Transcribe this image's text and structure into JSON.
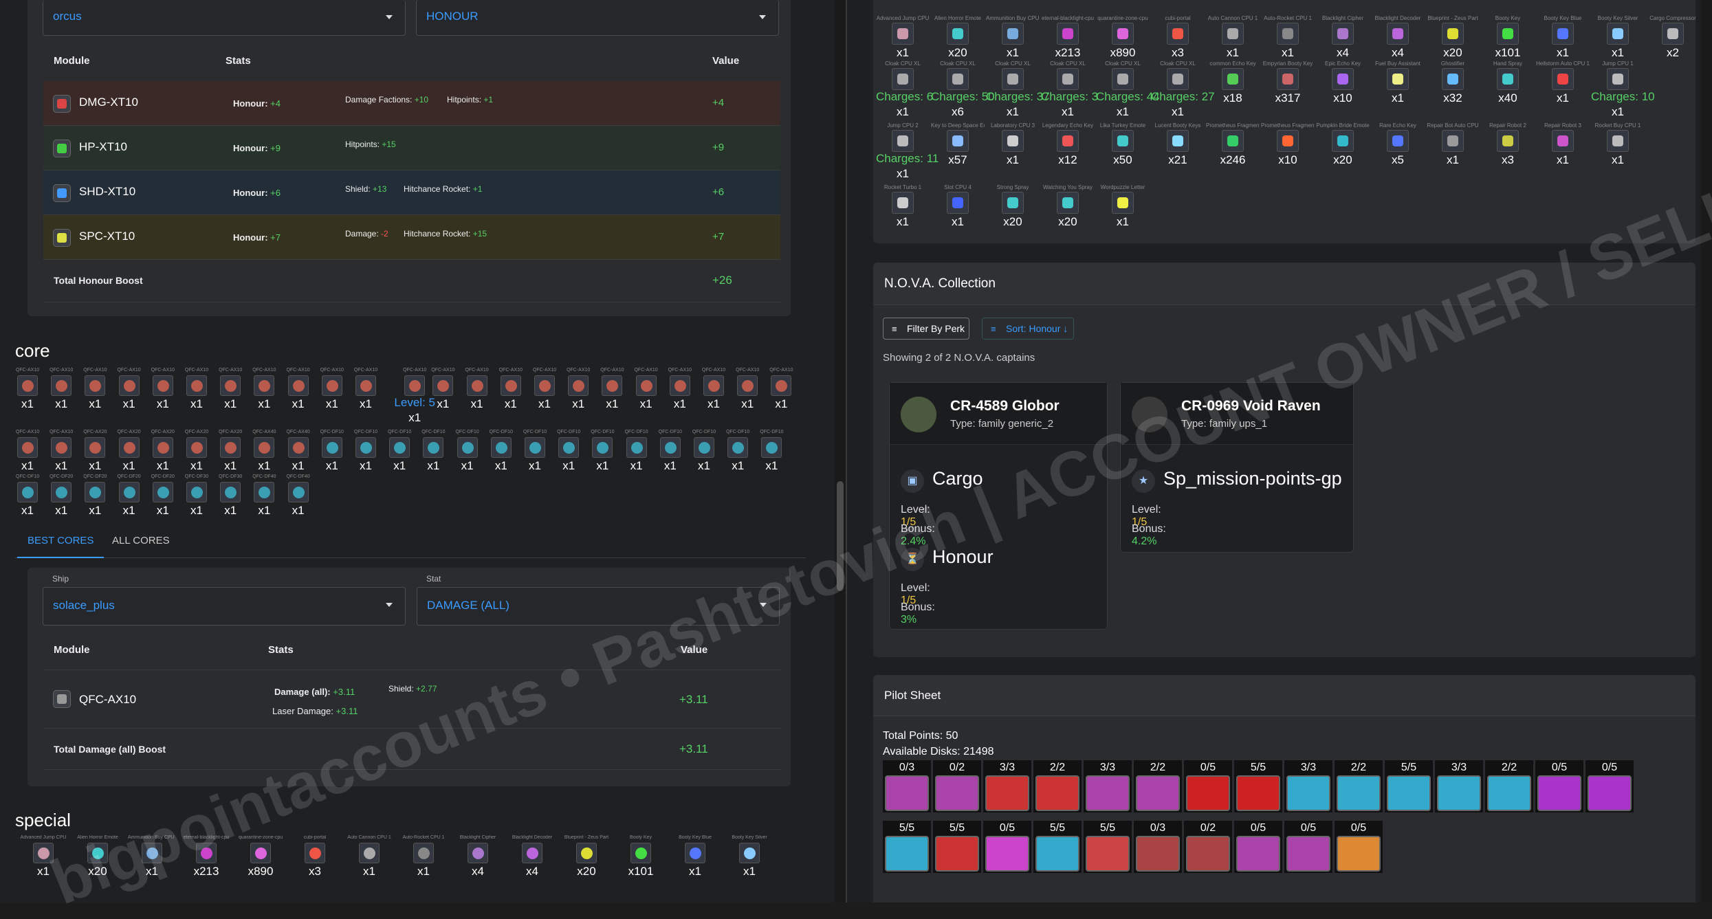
{
  "left": {
    "top_selects": {
      "ship": "orcus",
      "stat": "HONOUR"
    },
    "honour_table": {
      "headers": [
        "Module",
        "Stats",
        "Value"
      ],
      "rows": [
        {
          "module": "DMG-XT10",
          "honour_label": "Honour:",
          "honour_val": "+4",
          "s1_label": "Damage Factions:",
          "s1_val": "+10",
          "s2_label": "Hitpoints:",
          "s2_val": "+1",
          "value": "+4",
          "bg": "#3a2926",
          "icon": "#d44"
        },
        {
          "module": "HP-XT10",
          "honour_label": "Honour:",
          "honour_val": "+9",
          "s1_label": "Hitpoints:",
          "s1_val": "+15",
          "s2_label": "",
          "s2_val": "",
          "value": "+9",
          "bg": "#27332a",
          "icon": "#4c4"
        },
        {
          "module": "SHD-XT10",
          "honour_label": "Honour:",
          "honour_val": "+6",
          "s1_label": "Shield:",
          "s1_val": "+13",
          "s2_label": "Hitchance Rocket:",
          "s2_val": "+1",
          "value": "+6",
          "bg": "#232d38",
          "icon": "#49f"
        },
        {
          "module": "SPC-XT10",
          "honour_label": "Honour:",
          "honour_val": "+7",
          "s1_label": "Damage:",
          "s1_val": "-2",
          "s2_label": "Hitchance Rocket:",
          "s2_val": "+15",
          "value": "+7",
          "bg": "#35331f",
          "icon": "#dd4"
        }
      ],
      "total_label": "Total Honour Boost",
      "total_value": "+26"
    },
    "core_title": "core",
    "core_level_text": "Level: 5",
    "tabs": [
      "BEST CORES",
      "ALL CORES"
    ],
    "core_selects": {
      "ship_label": "Ship",
      "ship": "solace_plus",
      "stat_label": "Stat",
      "stat": "DAMAGE (ALL)"
    },
    "core_table": {
      "headers": [
        "Module",
        "Stats",
        "Value"
      ],
      "module": "QFC-AX10",
      "s1_label": "Damage (all):",
      "s1_val": "+3.11",
      "s2_label": "Shield:",
      "s2_val": "+2.77",
      "s3_label": "Laser Damage:",
      "s3_val": "+3.11",
      "value": "+3.11",
      "total_label": "Total Damage (all) Boost",
      "total_value": "+3.11"
    },
    "special_title": "special",
    "special_items": [
      {
        "name": "Advanced Jump CPU",
        "count": "x1",
        "color": "#c9a"
      },
      {
        "name": "Alien Horror Emote",
        "count": "x20",
        "color": "#4cc"
      },
      {
        "name": "Ammunition Buy CPU 1",
        "count": "x1",
        "color": "#7ad"
      },
      {
        "name": "eternal-blacklight-cpu",
        "count": "x213",
        "color": "#c4c"
      },
      {
        "name": "quarantine-zone-cpu",
        "count": "x890",
        "color": "#d6d"
      },
      {
        "name": "cubi-portal",
        "count": "x3",
        "color": "#e54"
      },
      {
        "name": "Auto Cannon CPU 1",
        "count": "x1",
        "color": "#aaa"
      },
      {
        "name": "Auto-Rocket CPU 1",
        "count": "x1",
        "color": "#888"
      },
      {
        "name": "Blacklight Cipher",
        "count": "x4",
        "color": "#a7c"
      },
      {
        "name": "Blacklight Decoder",
        "count": "x4",
        "color": "#b6d"
      },
      {
        "name": "Blueprint - Zeus Part",
        "count": "x20",
        "color": "#dd3"
      },
      {
        "name": "Booty Key",
        "count": "x101",
        "color": "#4d4"
      },
      {
        "name": "Booty Key Blue",
        "count": "x1",
        "color": "#57f"
      },
      {
        "name": "Booty Key Silver",
        "count": "x1",
        "color": "#8cf"
      }
    ],
    "core_names": [
      "QFC-AX10",
      "QFC-AX20",
      "QFC-AX40",
      "QFC-DF10",
      "QFC-DF20",
      "QFC-DF30",
      "QFC-DF40"
    ]
  },
  "right": {
    "special_rows": [
      [
        {
          "name": "Advanced Jump CPU",
          "count": "x1",
          "color": "#c9a"
        },
        {
          "name": "Alien Horror Emote",
          "count": "x20",
          "color": "#4cc"
        },
        {
          "name": "Ammunition Buy CPU 1",
          "count": "x1",
          "color": "#7ad"
        },
        {
          "name": "eternal-blacklight-cpu",
          "count": "x213",
          "color": "#c4c"
        },
        {
          "name": "quarantine-zone-cpu",
          "count": "x890",
          "color": "#d6d"
        },
        {
          "name": "cubi-portal",
          "count": "x3",
          "color": "#e54"
        },
        {
          "name": "Auto Cannon CPU 1",
          "count": "x1",
          "color": "#aaa"
        },
        {
          "name": "Auto-Rocket CPU 1",
          "count": "x1",
          "color": "#888"
        },
        {
          "name": "Blacklight Cipher",
          "count": "x4",
          "color": "#a7c"
        },
        {
          "name": "Blacklight Decoder",
          "count": "x4",
          "color": "#b6d"
        },
        {
          "name": "Blueprint - Zeus Part",
          "count": "x20",
          "color": "#dd3"
        },
        {
          "name": "Booty Key",
          "count": "x101",
          "color": "#4d4"
        },
        {
          "name": "Booty Key Blue",
          "count": "x1",
          "color": "#57f"
        },
        {
          "name": "Booty Key Silver",
          "count": "x1",
          "color": "#8cf"
        },
        {
          "name": "Cargo Compressor",
          "count": "x2",
          "color": "#bbb"
        }
      ],
      [
        {
          "name": "Cloak CPU XL",
          "charges": "Charges: 6",
          "count": "x1",
          "color": "#aaa"
        },
        {
          "name": "Cloak CPU XL",
          "charges": "Charges: 50",
          "count": "x6",
          "color": "#aaa"
        },
        {
          "name": "Cloak CPU XL",
          "charges": "Charges: 37",
          "count": "x1",
          "color": "#aaa"
        },
        {
          "name": "Cloak CPU XL",
          "charges": "Charges: 3",
          "count": "x1",
          "color": "#aaa"
        },
        {
          "name": "Cloak CPU XL",
          "charges": "Charges: 44",
          "count": "x1",
          "color": "#aaa"
        },
        {
          "name": "Cloak CPU XL",
          "charges": "Charges: 27",
          "count": "x1",
          "color": "#aaa"
        },
        {
          "name": "common Echo Key",
          "charges": "",
          "count": "x18",
          "color": "#5c5"
        },
        {
          "name": "Empyrian Booty Key",
          "charges": "",
          "count": "x317",
          "color": "#c66"
        },
        {
          "name": "Epic Echo Key",
          "charges": "",
          "count": "x10",
          "color": "#a6e"
        },
        {
          "name": "Fuel Buy Assistant",
          "charges": "",
          "count": "x1",
          "color": "#ee8"
        },
        {
          "name": "Ghostifier",
          "charges": "",
          "count": "x32",
          "color": "#6bf"
        },
        {
          "name": "Hand Spray",
          "charges": "",
          "count": "x40",
          "color": "#4cc"
        },
        {
          "name": "Hellstorm Auto CPU 1",
          "charges": "",
          "count": "x1",
          "color": "#e44"
        },
        {
          "name": "Jump CPU 1",
          "charges": "Charges: 10",
          "count": "x1",
          "color": "#bbb"
        }
      ],
      [
        {
          "name": "Jump CPU 2",
          "charges": "Charges: 11",
          "count": "x1",
          "color": "#bbb"
        },
        {
          "name": "Key to Deep Space Echoes",
          "charges": "",
          "count": "x57",
          "color": "#8bf"
        },
        {
          "name": "Laboratory CPU 3",
          "charges": "",
          "count": "x1",
          "color": "#ccc"
        },
        {
          "name": "Legendary Echo Key",
          "charges": "",
          "count": "x12",
          "color": "#e55"
        },
        {
          "name": "Lika Turkey Emote",
          "charges": "",
          "count": "x50",
          "color": "#4cc"
        },
        {
          "name": "Lucent Booty Keys",
          "charges": "",
          "count": "x21",
          "color": "#8df"
        },
        {
          "name": "Prometheus Fragment",
          "charges": "",
          "count": "x246",
          "color": "#3c6"
        },
        {
          "name": "Prometheus Fragment",
          "charges": "",
          "count": "x10",
          "color": "#f63"
        },
        {
          "name": "Pumpkin Bride Emote",
          "charges": "",
          "count": "x20",
          "color": "#3bc"
        },
        {
          "name": "Rare Echo Key",
          "charges": "",
          "count": "x5",
          "color": "#57f"
        },
        {
          "name": "Repair Bot Auto CPU",
          "charges": "",
          "count": "x1",
          "color": "#999"
        },
        {
          "name": "Repair Robot 2",
          "charges": "",
          "count": "x3",
          "color": "#cc4"
        },
        {
          "name": "Repair Robot 3",
          "charges": "",
          "count": "x1",
          "color": "#c5c"
        },
        {
          "name": "Rocket Buy CPU 1",
          "charges": "",
          "count": "x1",
          "color": "#bbb"
        }
      ],
      [
        {
          "name": "Rocket Turbo 1",
          "charges": "",
          "count": "x1",
          "color": "#ccc"
        },
        {
          "name": "Slot CPU 4",
          "charges": "",
          "count": "x1",
          "color": "#46f"
        },
        {
          "name": "Strong Spray",
          "charges": "",
          "count": "x20",
          "color": "#4cc"
        },
        {
          "name": "Watching You Spray",
          "charges": "",
          "count": "x20",
          "color": "#4cc"
        },
        {
          "name": "Wordpuzzle Letter",
          "charges": "",
          "count": "x1",
          "color": "#ee4"
        }
      ]
    ],
    "nova": {
      "title": "N.O.V.A. Collection",
      "filter_btn": "Filter By Perk",
      "sort_btn": "Sort: Honour ↓",
      "showing": "Showing 2 of 2 N.O.V.A. captains",
      "captains": [
        {
          "name": "CR-4589 Globor",
          "type": "Type: family generic_2",
          "perks": [
            {
              "icon": "▣",
              "name": "Cargo",
              "level_label": "Level:",
              "level": "1/5",
              "bonus_label": "Bonus:",
              "bonus": "2.4%"
            },
            {
              "icon": "⏳",
              "name": "Honour",
              "level_label": "Level:",
              "level": "1/5",
              "bonus_label": "Bonus:",
              "bonus": "3%"
            }
          ]
        },
        {
          "name": "CR-0969 Void Raven",
          "type": "Type: family ups_1",
          "perks": [
            {
              "icon": "★",
              "name": "Sp_mission-points-gp",
              "level_label": "Level:",
              "level": "1/5",
              "bonus_label": "Bonus:",
              "bonus": "4.2%"
            }
          ]
        }
      ]
    },
    "pilot": {
      "title": "Pilot Sheet",
      "total_points": "Total Points: 50",
      "available_disks": "Available Disks: 21498",
      "row1": [
        {
          "v": "0/3",
          "c": "#a4a"
        },
        {
          "v": "0/2",
          "c": "#a4a"
        },
        {
          "v": "3/3",
          "c": "#c33"
        },
        {
          "v": "2/2",
          "c": "#c33"
        },
        {
          "v": "3/3",
          "c": "#a4a"
        },
        {
          "v": "2/2",
          "c": "#a4a"
        },
        {
          "v": "0/5",
          "c": "#c22"
        },
        {
          "v": "5/5",
          "c": "#c22"
        },
        {
          "v": "3/3",
          "c": "#3ac"
        },
        {
          "v": "2/2",
          "c": "#3ac"
        },
        {
          "v": "5/5",
          "c": "#3ac"
        },
        {
          "v": "3/3",
          "c": "#3ac"
        },
        {
          "v": "2/2",
          "c": "#3ac"
        },
        {
          "v": "0/5",
          "c": "#a3c"
        },
        {
          "v": "0/5",
          "c": "#a3c"
        }
      ],
      "row2": [
        {
          "v": "5/5",
          "c": "#3ac"
        },
        {
          "v": "5/5",
          "c": "#c33"
        },
        {
          "v": "0/5",
          "c": "#c4c"
        },
        {
          "v": "5/5",
          "c": "#3ac"
        },
        {
          "v": "5/5",
          "c": "#c44"
        },
        {
          "v": "0/3",
          "c": "#a44"
        },
        {
          "v": "0/2",
          "c": "#a44"
        },
        {
          "v": "0/5",
          "c": "#a4a"
        },
        {
          "v": "0/5",
          "c": "#a4a"
        },
        {
          "v": "0/5",
          "c": "#d83"
        }
      ]
    },
    "special_title_partial": "special"
  },
  "watermark": "bigpointaccounts • Pashtetovich | ACCOUNT OWNER / SELLER"
}
